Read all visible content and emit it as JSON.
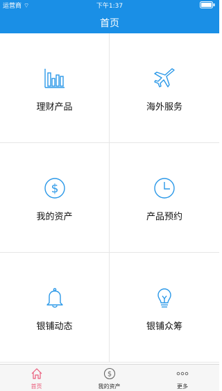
{
  "status_bar": {
    "carrier": "运营商",
    "time": "下午1:37"
  },
  "navbar": {
    "title": "首页"
  },
  "grid": {
    "items": [
      {
        "label": "理财产品",
        "icon": "bar-chart-icon"
      },
      {
        "label": "海外服务",
        "icon": "airplane-icon"
      },
      {
        "label": "我的资产",
        "icon": "dollar-coin-icon"
      },
      {
        "label": "产品预约",
        "icon": "clock-icon"
      },
      {
        "label": "银铺动态",
        "icon": "bell-icon"
      },
      {
        "label": "银铺众筹",
        "icon": "lightbulb-icon"
      }
    ]
  },
  "tabbar": {
    "items": [
      {
        "label": "首页",
        "icon": "home-icon",
        "active": true
      },
      {
        "label": "我的资产",
        "icon": "dollar-coin-icon",
        "active": false
      },
      {
        "label": "更多",
        "icon": "more-dots-icon",
        "active": false
      }
    ]
  },
  "colors": {
    "primary": "#1a8fe6",
    "active_tab": "#ea5b7a",
    "icon": "#2a98e8"
  }
}
